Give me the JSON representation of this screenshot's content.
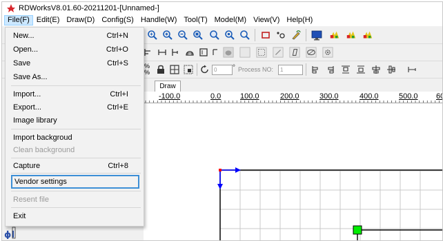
{
  "window": {
    "title": "RDWorksV8.01.60-20211201-[Unnamed-]"
  },
  "menubar": {
    "items": [
      {
        "label": "File(F)"
      },
      {
        "label": "Edit(E)"
      },
      {
        "label": "Draw(D)"
      },
      {
        "label": "Config(S)"
      },
      {
        "label": "Handle(W)"
      },
      {
        "label": "Tool(T)"
      },
      {
        "label": "Model(M)"
      },
      {
        "label": "View(V)"
      },
      {
        "label": "Help(H)"
      }
    ]
  },
  "file_menu": {
    "items": [
      {
        "label": "New...",
        "shortcut": "Ctrl+N"
      },
      {
        "label": "Open...",
        "shortcut": "Ctrl+O"
      },
      {
        "label": "Save",
        "shortcut": "Ctrl+S"
      },
      {
        "label": "Save As...",
        "shortcut": ""
      },
      {
        "label": "Import...",
        "shortcut": "Ctrl+I"
      },
      {
        "label": "Export...",
        "shortcut": "Ctrl+E"
      },
      {
        "label": "Image library",
        "shortcut": ""
      },
      {
        "label": "Import backgroud",
        "shortcut": ""
      },
      {
        "label": "Clean background",
        "shortcut": ""
      },
      {
        "label": "Capture",
        "shortcut": "Ctrl+8"
      },
      {
        "label": "Vendor settings",
        "shortcut": ""
      },
      {
        "label": "Resent file",
        "shortcut": ""
      },
      {
        "label": "Exit",
        "shortcut": ""
      }
    ]
  },
  "toolbar3": {
    "angle_value": "0",
    "process_label": "Process NO:",
    "process_value": "1",
    "angle_unit": "°"
  },
  "tab": {
    "draw_label": "Draw"
  },
  "ruler": {
    "labels": [
      "-100.0",
      "0.0",
      "100.0",
      "200.0",
      "300.0",
      "400.0",
      "500.0",
      "60"
    ]
  },
  "colors": {
    "highlight_border": "#3d8fd6",
    "menu_active_bg": "#cce8ff",
    "origin_marker": "#ff0000",
    "axis_arrow": "#0000ff",
    "grid_line": "#c8c8c8",
    "selection_handle": "#00ee00"
  }
}
